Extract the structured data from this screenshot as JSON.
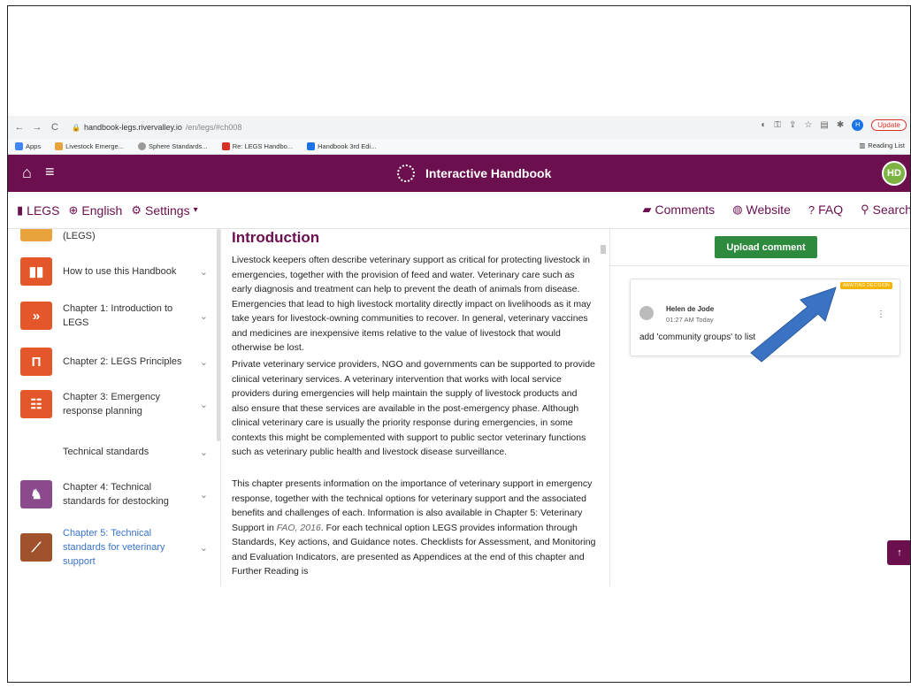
{
  "browser": {
    "url_host": "handbook-legs.rivervalley.io",
    "url_path": "/en/legs/#ch008",
    "profile_initial": "H",
    "update_label": "Update",
    "bookmarks": [
      {
        "label": "Apps",
        "color": "#4285f4"
      },
      {
        "label": "Livestock Emerge...",
        "color": "#e8a33d"
      },
      {
        "label": "Sphere Standards...",
        "color": "#999999"
      },
      {
        "label": "Re: LEGS Handbo...",
        "color": "#d93025"
      },
      {
        "label": "Handbook 3rd Edi...",
        "color": "#1a73e8"
      }
    ],
    "reading_list": "Reading List"
  },
  "app": {
    "title": "Interactive Handbook",
    "user_initials": "HD",
    "accent": "#6b0f4f"
  },
  "subnav": {
    "legs": "LEGS",
    "language": "English",
    "settings": "Settings",
    "comments": "Comments",
    "website": "Website",
    "faq": "FAQ",
    "search": "Search"
  },
  "sidebar": {
    "items": [
      {
        "label": "(LEGS)",
        "icon": "chart-icon",
        "color": "#e8a33d"
      },
      {
        "label": "How to use this Handbook",
        "icon": "book-icon",
        "color": "#e3572a"
      },
      {
        "label": "Chapter 1: Introduction to LEGS",
        "icon": "chevrons-icon",
        "color": "#e3572a"
      },
      {
        "label": "Chapter 2: LEGS Principles",
        "icon": "pillar-icon",
        "color": "#e3572a"
      },
      {
        "label": "Chapter 3: Emergency response planning",
        "icon": "people-icon",
        "color": "#e3572a"
      },
      {
        "label": "Technical standards",
        "icon": "",
        "color": ""
      },
      {
        "label": "Chapter 4: Technical standards for destocking",
        "icon": "livestock-icon",
        "color": "#8a4a8c"
      },
      {
        "label": "Chapter 5: Technical standards for veterinary support",
        "icon": "syringe-icon",
        "color": "#a0522d"
      }
    ]
  },
  "content": {
    "heading": "Introduction",
    "p1": "Livestock keepers often describe veterinary support as critical for protecting livestock in emergencies, together with the provision of feed and water. Veterinary care such as early diagnosis and treatment can help to prevent the death of animals from disease. Emergencies that lead to high livestock mortality directly impact on livelihoods as it may take years for livestock-owning communities to recover. In general, veterinary vaccines and medicines are inexpensive items relative to the value of livestock that would otherwise be lost.",
    "p2": "Private veterinary service providers, NGO and governments can be supported to provide clinical veterinary services. A veterinary intervention that works with local service providers during emergencies will help maintain the supply of livestock products and also ensure that these services are available in the post-emergency phase. Although clinical veterinary care is usually the priority response during emergencies, in some contexts this might be complemented with support to public sector veterinary functions such as veterinary public health and livestock disease surveillance.",
    "p3_a": "This chapter presents information on the importance of veterinary support in emergency response, together with the technical options for veterinary support and the associated benefits and challenges of each. Information is also available in Chapter 5: Veterinary Support in ",
    "p3_ref": "FAO, 2016",
    "p3_b": ". For each technical option LEGS provides information through Standards, Key actions, and Guidance notes. Checklists for Assessment, and Monitoring and Evaluation Indicators, are presented as Appendices at the end of this chapter and Further Reading is"
  },
  "comments": {
    "upload_label": "Upload comment",
    "badge": "AWAITING DECISION",
    "author": "Helen de Jode",
    "time": "01:27 AM Today",
    "text": "add 'community groups' to list"
  }
}
